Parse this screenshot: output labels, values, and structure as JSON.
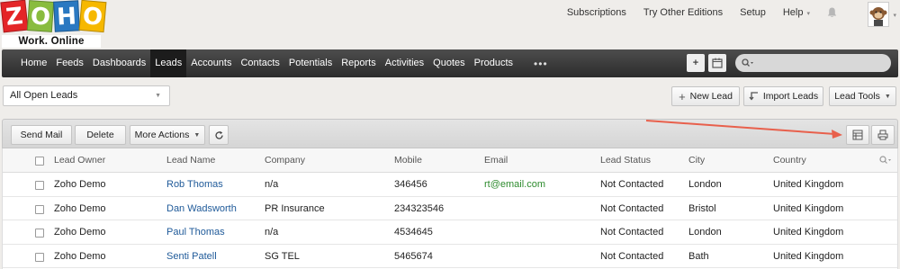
{
  "logo": {
    "letters": [
      "Z",
      "O",
      "H",
      "O"
    ],
    "letter_colors": [
      "#e42527",
      "#89bc3f",
      "#2a78c1",
      "#f6b800"
    ],
    "tagline": "Work. Online"
  },
  "header": {
    "links": [
      "Subscriptions",
      "Try Other Editions",
      "Setup",
      "Help"
    ],
    "help_caret": "▾",
    "avatar_caret": "▾"
  },
  "nav": {
    "items": [
      "Home",
      "Feeds",
      "Dashboards",
      "Leads",
      "Accounts",
      "Contacts",
      "Potentials",
      "Reports",
      "Activities",
      "Quotes",
      "Products"
    ],
    "active": "Leads",
    "more": "•••",
    "search_placeholder": ""
  },
  "view": {
    "selected": "All Open Leads"
  },
  "actions": {
    "new_lead": "New Lead",
    "import_leads": "Import Leads",
    "lead_tools": "Lead Tools"
  },
  "toolbar": {
    "send_mail": "Send Mail",
    "delete": "Delete",
    "more_actions": "More Actions"
  },
  "table": {
    "columns": [
      "Lead Owner",
      "Lead Name",
      "Company",
      "Mobile",
      "Email",
      "Lead Status",
      "City",
      "Country"
    ],
    "rows": [
      [
        "Zoho Demo",
        "Rob Thomas",
        "n/a",
        "346456",
        "rt@email.com",
        "Not Contacted",
        "London",
        "United Kingdom"
      ],
      [
        "Zoho Demo",
        "Dan Wadsworth",
        "PR Insurance",
        "234323546",
        "",
        "Not Contacted",
        "Bristol",
        "United Kingdom"
      ],
      [
        "Zoho Demo",
        "Paul Thomas",
        "n/a",
        "4534645",
        "",
        "Not Contacted",
        "London",
        "United Kingdom"
      ],
      [
        "Zoho Demo",
        "Senti Patell",
        "SG TEL",
        "5465674",
        "",
        "Not Contacted",
        "Bath",
        "United Kingdom"
      ]
    ]
  },
  "colors": {
    "link": "#1f5a99",
    "email": "#2e8b2e",
    "annotation_arrow": "#e8604c"
  }
}
